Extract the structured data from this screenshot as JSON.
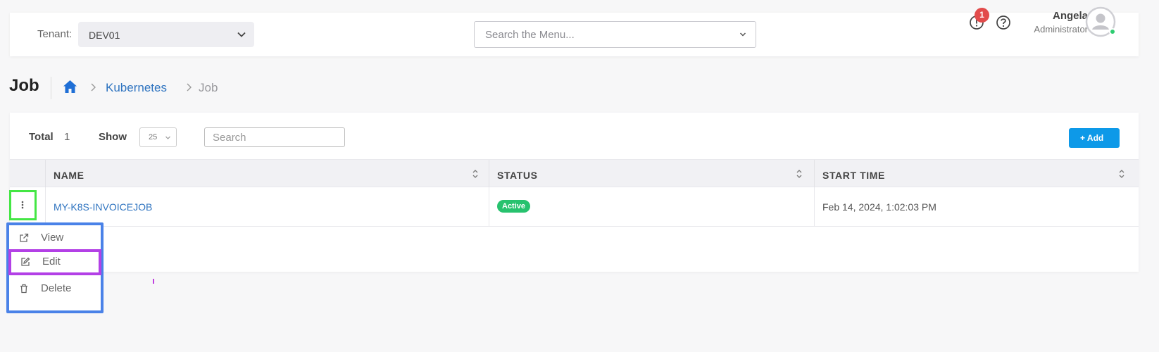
{
  "header": {
    "tenant_label": "Tenant:",
    "tenant_value": "DEV01",
    "menu_search_placeholder": "Search the Menu...",
    "alert_count": "1",
    "user_name": "Angela",
    "user_role": "Administrator"
  },
  "page": {
    "title": "Job",
    "breadcrumb": {
      "link": "Kubernetes",
      "current": "Job"
    }
  },
  "toolbar": {
    "total_label": "Total",
    "total_value": "1",
    "show_label": "Show",
    "show_value": "25",
    "search_placeholder": "Search",
    "add_label": "+ Add"
  },
  "table": {
    "columns": [
      "NAME",
      "STATUS",
      "START TIME"
    ],
    "rows": [
      {
        "name": "MY-K8S-INVOICEJOB",
        "status": "Active",
        "start_time": "Feb 14, 2024, 1:02:03 PM"
      }
    ]
  },
  "row_menu": {
    "items": [
      "View",
      "Edit",
      "Delete"
    ]
  },
  "colors": {
    "accent": "#0d99e8",
    "link": "#2f74c0",
    "status_active": "#27c26e",
    "alert": "#e24b4b"
  }
}
